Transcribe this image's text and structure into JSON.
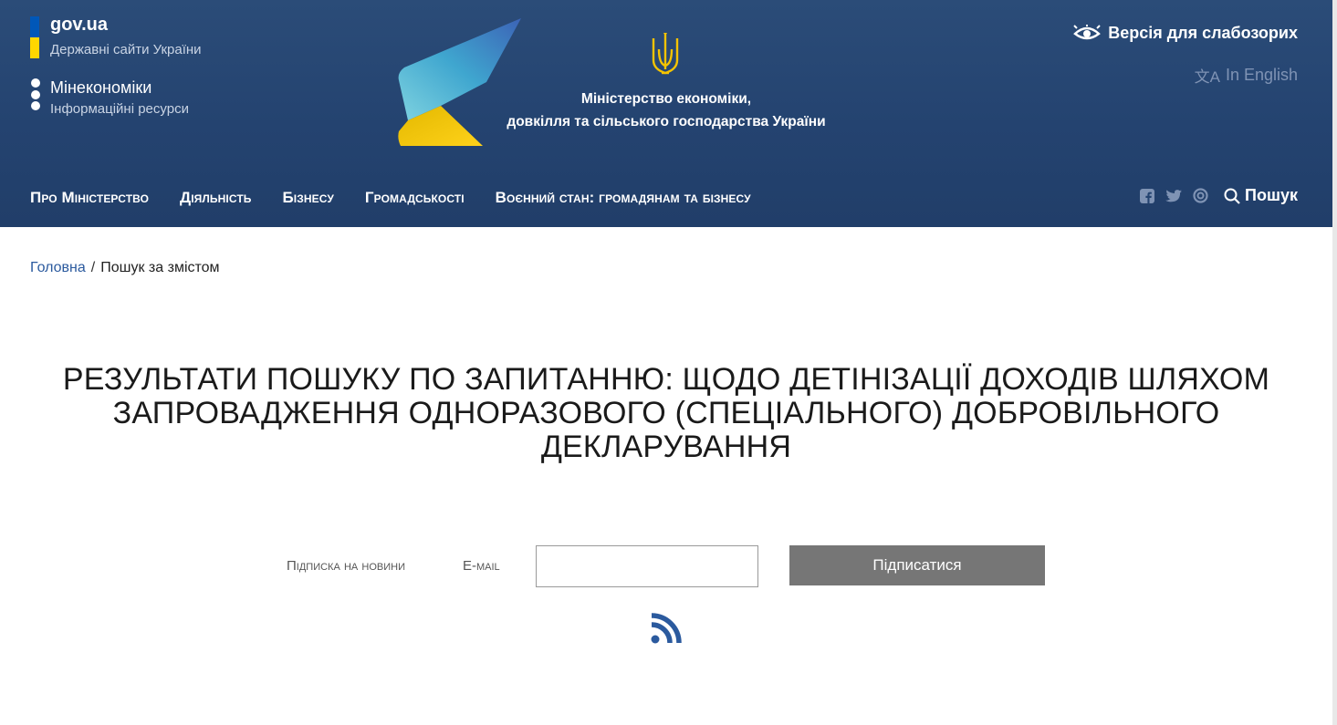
{
  "header": {
    "gov_title": "gov.ua",
    "gov_subtitle": "Державні сайти України",
    "ministry_short": "Мінекономіки",
    "ministry_sub": "Інформаційні ресурси",
    "ministry_name_line1": "Міністерство економіки,",
    "ministry_name_line2": "довкілля та сільського господарства України",
    "low_vision": "Версія для слабозорих",
    "language": "In English",
    "nav": [
      {
        "label": "Про Міністерство"
      },
      {
        "label": "Діяльність"
      },
      {
        "label": "Бізнесу"
      },
      {
        "label": "Громадськості"
      },
      {
        "label": "Воєнний стан: громадянам та бізнесу"
      }
    ],
    "search_label": "Пошук",
    "social_icons": [
      "facebook-icon",
      "twitter-icon",
      "instagram-icon"
    ]
  },
  "breadcrumb": {
    "home": "Головна",
    "separator": "/",
    "current": "Пошук за змістом"
  },
  "main": {
    "title": "Результати пошуку по запитанню: щодо детінізації доходів шляхом запровадження одноразового (спеціального) добровільного декларування"
  },
  "subscribe": {
    "label": "Підписка на новини",
    "email_label": "E-mail",
    "email_value": "",
    "button_label": "Підписатися"
  },
  "colors": {
    "header_bg": "#244370",
    "link": "#2b5a9e",
    "button_bg": "#767676",
    "flag_blue": "#0057b8",
    "flag_yellow": "#ffd700"
  }
}
